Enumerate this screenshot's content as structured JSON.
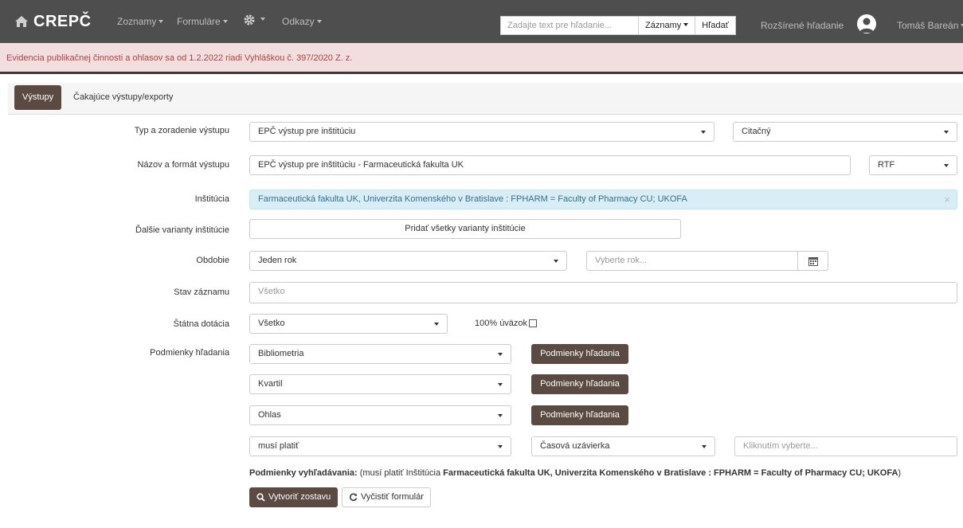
{
  "navbar": {
    "brand": "CREPČ",
    "menu": [
      "Zoznamy",
      "Formuláre",
      "Odkazy"
    ],
    "search_placeholder": "Zadajte text pre hľadanie...",
    "search_scope": "Záznamy",
    "search_button": "Hľadať",
    "advanced_search": "Rozšírené hľadanie",
    "user": "Tomáš Bareán"
  },
  "alert": {
    "text": "Evidencia publikačnej činnosti a ohlasov sa od 1.2.2022 riadi Vyhláškou č. 397/2020 Z. z."
  },
  "tabs": [
    "Výstupy",
    "Čakajúce výstupy/exporty"
  ],
  "form": {
    "type_label": "Typ a zoradenie výstupu",
    "type_value": "EPČ výstup pre inštitúciu",
    "order_value": "Citačný",
    "name_label": "Názov a formát výstupu",
    "name_value": "EPČ výstup pre inštitúciu - Farmaceutická fakulta UK",
    "format_value": "RTF",
    "institution_label": "Inštitúcia",
    "institution_value": "Farmaceutická fakulta UK, Univerzita Komenského v Bratislave : FPHARM = Faculty of Pharmacy CU; UKOFA",
    "variants_label": "Ďalšie varianty inštitúcie",
    "variants_button": "Pridať všetky varianty inštitúcie",
    "period_label": "Obdobie",
    "period_value": "Jeden rok",
    "year_placeholder": "Vyberte rok...",
    "status_label": "Stav záznamu",
    "status_value": "Všetko",
    "grant_label": "Štátna dotácia",
    "grant_value": "Všetko",
    "workload_label": "100% úväzok",
    "conditions_label": "Podmienky hľadania",
    "conditions": [
      {
        "value": "Bibliometria",
        "button": "Podmienky hľadania"
      },
      {
        "value": "Kvartil",
        "button": "Podmienky hľadania"
      },
      {
        "value": "Ohlas",
        "button": "Podmienky hľadania"
      }
    ],
    "must_value": "musí platiť",
    "closing_value": "Časová uzávierka",
    "closing_placeholder": "Kliknutím vyberte...",
    "summary_label": "Podmienky vyhľadávania:",
    "summary_prefix": "(musí platiť Inštitúcia",
    "summary_value": "Farmaceutická fakulta UK, Univerzita Komenského v Bratislave : FPHARM = Faculty of Pharmacy CU; UKOFA",
    "summary_suffix": ")",
    "create_button": "Vytvoriť zostavu",
    "clear_button": "Vyčistiť formulár"
  },
  "colors": {
    "navbar": "#4e4e4e",
    "accent": "#5b4a42",
    "alert_bg": "#f2dede",
    "alert_text": "#a94442",
    "info_bg": "#d9edf7"
  }
}
